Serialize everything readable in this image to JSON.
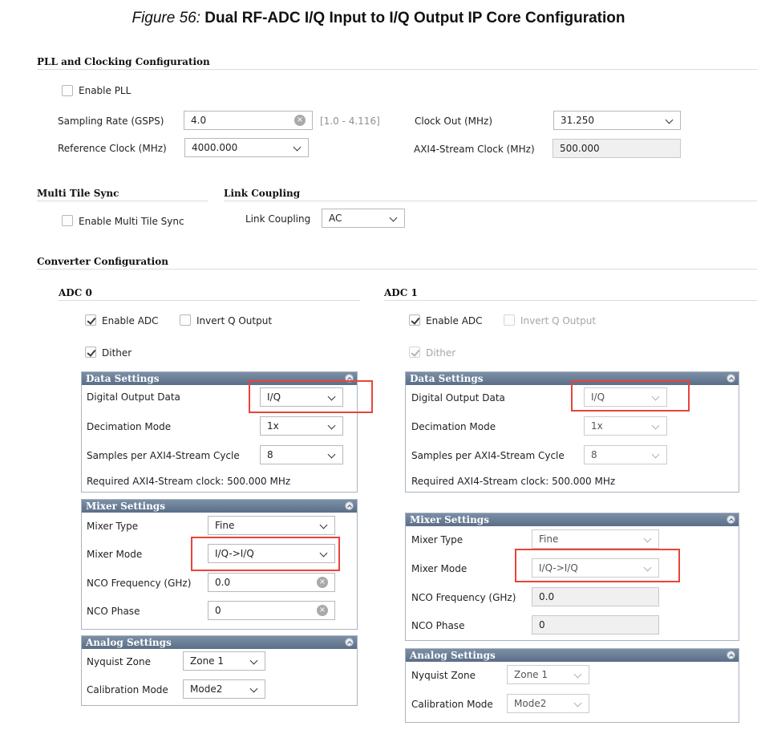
{
  "figure": {
    "prefix": "Figure 56:",
    "title": "Dual RF-ADC I/Q Input to I/Q Output IP Core Configuration"
  },
  "pll": {
    "title": "PLL and Clocking Configuration",
    "enable_pll_label": "Enable PLL",
    "enable_pll": false,
    "sampling_rate_label": "Sampling Rate (GSPS)",
    "sampling_rate": "4.0",
    "sampling_rate_range": "[1.0 - 4.116]",
    "ref_clock_label": "Reference Clock (MHz)",
    "ref_clock": "4000.000",
    "clock_out_label": "Clock Out (MHz)",
    "clock_out": "31.250",
    "axi_clock_label": "AXI4-Stream Clock (MHz)",
    "axi_clock": "500.000"
  },
  "mts": {
    "title": "Multi Tile Sync",
    "enable_label": "Enable Multi Tile Sync",
    "enabled": false
  },
  "link": {
    "title": "Link Coupling",
    "label": "Link Coupling",
    "value": "AC"
  },
  "converter": {
    "title": "Converter Configuration"
  },
  "adc0": {
    "title": "ADC 0",
    "enable_label": "Enable ADC",
    "enable": true,
    "invert_label": "Invert Q Output",
    "invert": false,
    "dither_label": "Dither",
    "dither": true,
    "data": {
      "title": "Data Settings",
      "output_label": "Digital Output Data",
      "output": "I/Q",
      "decimation_label": "Decimation Mode",
      "decimation": "1x",
      "samples_label": "Samples per AXI4-Stream Cycle",
      "samples": "8",
      "required": "Required AXI4-Stream clock: 500.000 MHz"
    },
    "mixer": {
      "title": "Mixer Settings",
      "type_label": "Mixer Type",
      "type": "Fine",
      "mode_label": "Mixer Mode",
      "mode": "I/Q->I/Q",
      "nco_freq_label": "NCO Frequency (GHz)",
      "nco_freq": "0.0",
      "nco_phase_label": "NCO Phase",
      "nco_phase": "0"
    },
    "analog": {
      "title": "Analog Settings",
      "nyquist_label": "Nyquist Zone",
      "nyquist": "Zone 1",
      "calib_label": "Calibration Mode",
      "calib": "Mode2"
    }
  },
  "adc1": {
    "title": "ADC 1",
    "enable_label": "Enable ADC",
    "enable": true,
    "invert_label": "Invert Q Output",
    "invert": false,
    "dither_label": "Dither",
    "dither": true,
    "data": {
      "title": "Data Settings",
      "output_label": "Digital Output Data",
      "output": "I/Q",
      "decimation_label": "Decimation Mode",
      "decimation": "1x",
      "samples_label": "Samples per AXI4-Stream Cycle",
      "samples": "8",
      "required": "Required AXI4-Stream clock: 500.000 MHz"
    },
    "mixer": {
      "title": "Mixer Settings",
      "type_label": "Mixer Type",
      "type": "Fine",
      "mode_label": "Mixer Mode",
      "mode": "I/Q->I/Q",
      "nco_freq_label": "NCO Frequency (GHz)",
      "nco_freq": "0.0",
      "nco_phase_label": "NCO Phase",
      "nco_phase": "0"
    },
    "analog": {
      "title": "Analog Settings",
      "nyquist_label": "Nyquist Zone",
      "nyquist": "Zone 1",
      "calib_label": "Calibration Mode",
      "calib": "Mode2"
    }
  },
  "colors": {
    "highlight": "#e8443a",
    "panel_header": "#6a7d96"
  }
}
